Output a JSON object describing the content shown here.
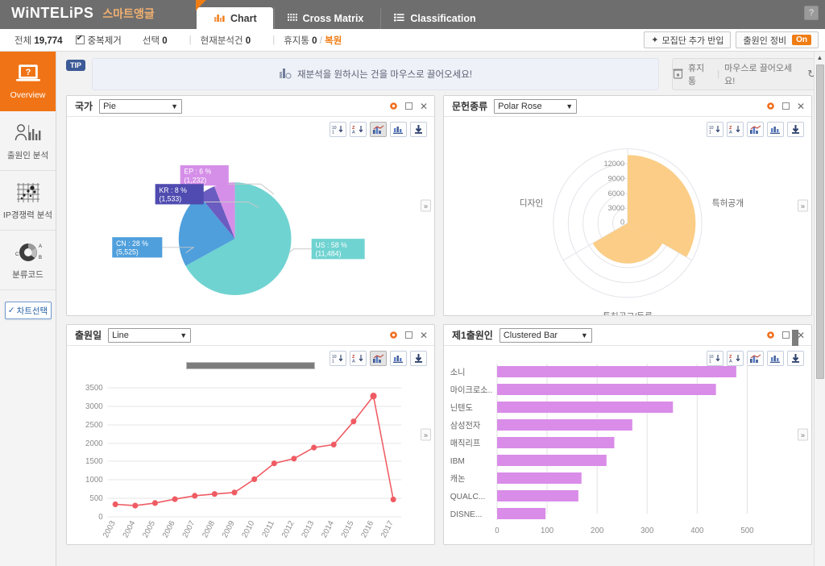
{
  "header": {
    "logo": "WiNTELiPS",
    "brand_sub": "스마트앵글",
    "help_icon": "question-icon",
    "tabs": [
      {
        "label": "Chart",
        "icon": "bar-chart-icon",
        "active": true
      },
      {
        "label": "Cross Matrix",
        "icon": "grid-icon",
        "active": false
      },
      {
        "label": "Classification",
        "icon": "list-icon",
        "active": false
      }
    ]
  },
  "infobar": {
    "total_label": "전체",
    "total_value": "19,774",
    "dedupe_label": "중복제거",
    "select_label": "선택",
    "select_value": "0",
    "current_label": "현재분석건",
    "current_value": "0",
    "trash_label": "휴지통",
    "trash_value": "0",
    "restore_label": "복원",
    "add_group_button": "모집단 추가 반입",
    "applicant_button": "출원인 정비",
    "applicant_state": "On"
  },
  "sidebar": {
    "items": [
      {
        "label": "Overview",
        "icon": "laptop-question-icon",
        "active": true
      },
      {
        "label": "출원인 분석",
        "icon": "person-bars-icon",
        "active": false
      },
      {
        "label": "IP경쟁력 분석",
        "icon": "scatter-grid-icon",
        "active": false
      },
      {
        "label": "분류코드",
        "icon": "donut-code-icon",
        "active": false
      }
    ],
    "chart_select_button": "차트선택"
  },
  "tip": {
    "badge": "TIP",
    "message": "재분석을 원하시는 건을 마우스로 끌어오세요!",
    "icon": "drag-chart-icon",
    "trash_label": "휴지통",
    "trash_hint": "마우스로 끌어오세요!",
    "refresh_icon": "refresh-icon"
  },
  "panel_controls": {
    "gear_icon": "gear-icon",
    "maximize_icon": "maximize-icon",
    "close_icon": "close-icon",
    "expander_icon": "chevron-right-icon",
    "toolbar": [
      {
        "name": "sort-numeric-icon",
        "label": "10\n1",
        "active": false
      },
      {
        "name": "sort-alpha-icon",
        "label": "Z\nA",
        "active": false
      },
      {
        "name": "chart-type-icon",
        "label": "",
        "active": true
      },
      {
        "name": "chart-data-icon",
        "label": "",
        "active": false
      },
      {
        "name": "download-icon",
        "label": "",
        "active": false
      }
    ]
  },
  "panels": [
    {
      "title": "국가",
      "chart_type": "Pie"
    },
    {
      "title": "문헌종류",
      "chart_type": "Polar Rose"
    },
    {
      "title": "출원일",
      "chart_type": "Line"
    },
    {
      "title": "제1출원인",
      "chart_type": "Clustered Bar"
    }
  ],
  "chart_data": [
    {
      "type": "pie",
      "title": "국가",
      "categories": [
        "US",
        "CN",
        "KR",
        "EP"
      ],
      "values": [
        11484,
        5525,
        1533,
        1232
      ],
      "percents": [
        58,
        28,
        8,
        6
      ],
      "labels": [
        "US : 58 %\n(11,484)",
        "CN : 28 %\n(5,525)",
        "KR : 8 %\n(1,533)",
        "EP : 6 %\n(1,232)"
      ],
      "colors": [
        "#6fd3d1",
        "#4f9fdc",
        "#6a5cc0",
        "#d58fe8"
      ],
      "legend": "labels-outside"
    },
    {
      "type": "polar",
      "title": "문헌종류",
      "categories": [
        "특허공개",
        "특허공고/등록",
        "디자인"
      ],
      "values": [
        11000,
        6500,
        0
      ],
      "tick_labels": [
        "0",
        "3000",
        "6000",
        "9000",
        "12000"
      ],
      "rlim": [
        0,
        12000
      ],
      "color": "#fbcd86",
      "grid": true
    },
    {
      "type": "line",
      "title": "출원일",
      "x": [
        "2003",
        "2004",
        "2005",
        "2006",
        "2007",
        "2008",
        "2009",
        "2010",
        "2011",
        "2012",
        "2013",
        "2014",
        "2015",
        "2016",
        "2017"
      ],
      "values": [
        340,
        305,
        375,
        480,
        570,
        620,
        660,
        1020,
        1450,
        1580,
        1880,
        1960,
        2600,
        3290,
        470
      ],
      "ytick_labels": [
        "0",
        "500",
        "1000",
        "1500",
        "2000",
        "2500",
        "3000",
        "3500"
      ],
      "ylim": [
        0,
        3500
      ],
      "color": "#ef5b63",
      "grid": true
    },
    {
      "type": "bar",
      "title": "제1출원인",
      "orientation": "horizontal",
      "categories": [
        "소니",
        "마이크로소..",
        "닌텐도",
        "삼성전자",
        "매직리프",
        "IBM",
        "캐논",
        "QUALC...",
        "DISNE..."
      ],
      "values": [
        478,
        437,
        352,
        270,
        234,
        218,
        168,
        162,
        97
      ],
      "xtick_labels": [
        "0",
        "100",
        "200",
        "300",
        "400",
        "500"
      ],
      "xlim": [
        0,
        550
      ],
      "color": "#d98ce8",
      "grid": true
    }
  ]
}
